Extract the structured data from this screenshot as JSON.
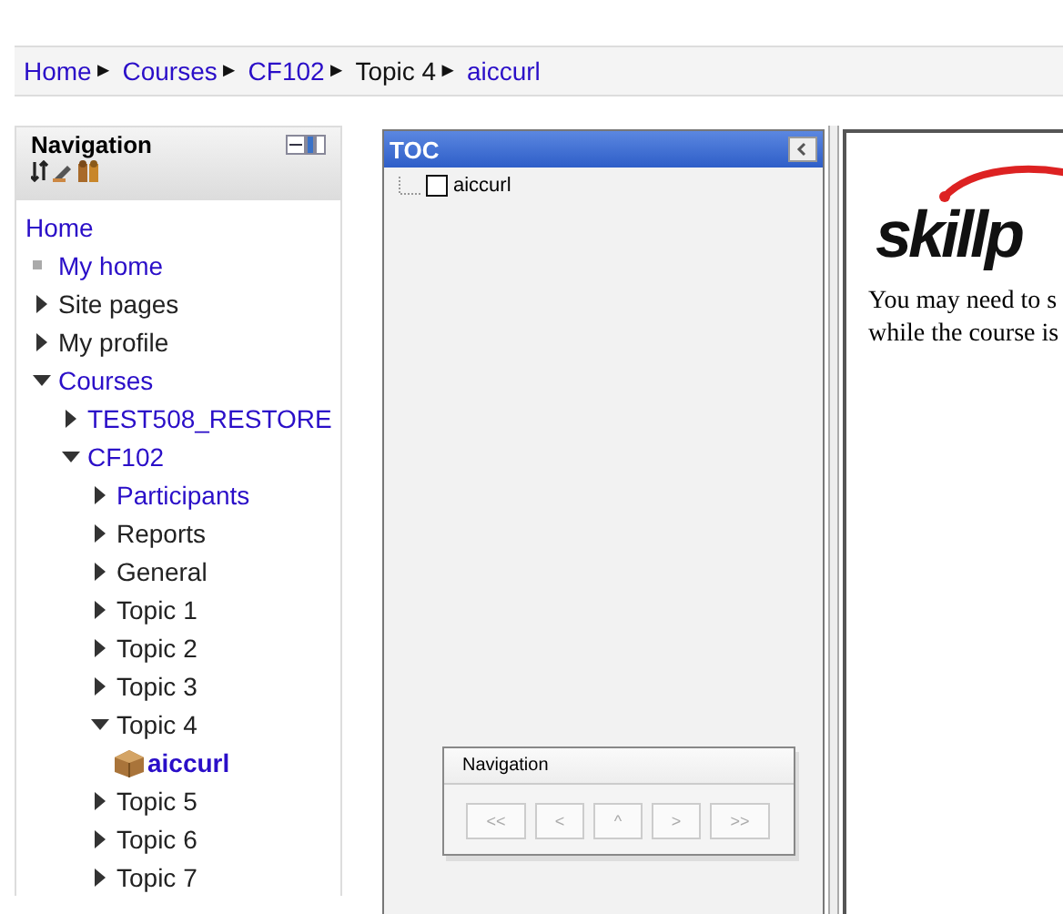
{
  "breadcrumb": [
    {
      "label": "Home",
      "link": true,
      "separator": "►"
    },
    {
      "label": "Courses",
      "link": true,
      "separator": "►"
    },
    {
      "label": "CF102",
      "link": true,
      "separator": "►"
    },
    {
      "label": "Topic 4",
      "link": false,
      "separator": "►"
    },
    {
      "label": "aiccurl",
      "link": true
    }
  ],
  "navigation": {
    "title": "Navigation",
    "items": [
      {
        "label": "Home",
        "kind": "root",
        "link": true
      },
      {
        "label": "My home",
        "kind": "leaf",
        "link": true
      },
      {
        "label": "Site pages",
        "kind": "branch",
        "link": false,
        "expanded": false
      },
      {
        "label": "My profile",
        "kind": "branch",
        "link": false,
        "expanded": false
      },
      {
        "label": "Courses",
        "kind": "branch",
        "link": true,
        "expanded": true,
        "children": [
          {
            "label": "TEST508_RESTORE",
            "kind": "branch",
            "link": true,
            "expanded": false
          },
          {
            "label": "CF102",
            "kind": "branch",
            "link": true,
            "expanded": true,
            "children": [
              {
                "label": "Participants",
                "kind": "branch",
                "link": true,
                "expanded": false
              },
              {
                "label": "Reports",
                "kind": "branch",
                "link": false,
                "expanded": false
              },
              {
                "label": "General",
                "kind": "branch",
                "link": false,
                "expanded": false
              },
              {
                "label": "Topic 1",
                "kind": "branch",
                "link": false,
                "expanded": false
              },
              {
                "label": "Topic 2",
                "kind": "branch",
                "link": false,
                "expanded": false
              },
              {
                "label": "Topic 3",
                "kind": "branch",
                "link": false,
                "expanded": false
              },
              {
                "label": "Topic 4",
                "kind": "branch",
                "link": false,
                "expanded": true,
                "children": [
                  {
                    "label": "aiccurl",
                    "kind": "activity",
                    "link": true
                  }
                ]
              },
              {
                "label": "Topic 5",
                "kind": "branch",
                "link": false,
                "expanded": false
              },
              {
                "label": "Topic 6",
                "kind": "branch",
                "link": false,
                "expanded": false
              },
              {
                "label": "Topic 7",
                "kind": "branch",
                "link": false,
                "expanded": false
              }
            ]
          }
        ]
      }
    ]
  },
  "toc": {
    "title": "TOC",
    "items": [
      {
        "label": "aiccurl",
        "checked": false
      }
    ]
  },
  "player_nav": {
    "title": "Navigation",
    "buttons": [
      {
        "label": "<<",
        "disabled": true
      },
      {
        "label": "<",
        "disabled": true
      },
      {
        "label": "^",
        "disabled": true
      },
      {
        "label": ">",
        "disabled": true
      },
      {
        "label": ">>",
        "disabled": true
      }
    ]
  },
  "content": {
    "logo": "skillp",
    "lines": [
      "You may need to s",
      "while the course is"
    ]
  }
}
